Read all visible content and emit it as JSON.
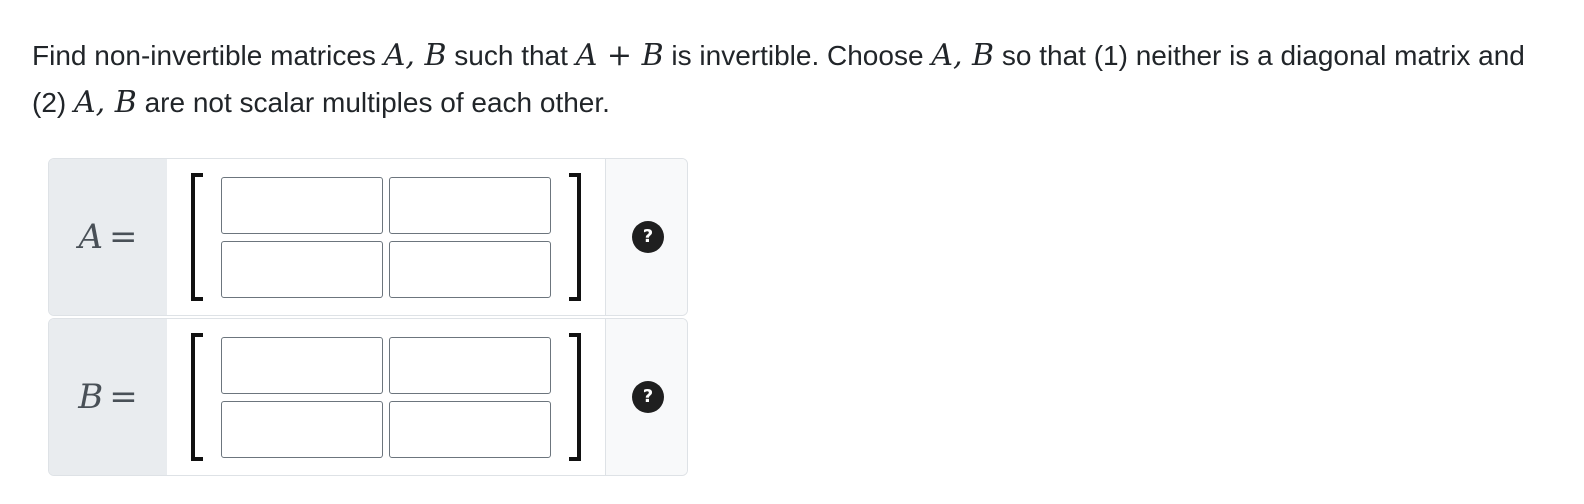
{
  "question": {
    "t1": "Find non-invertible matrices ",
    "m1": "A, B",
    "t2": " such that ",
    "m2a": "A",
    "m2op": " + ",
    "m2b": "B",
    "t3": " is invertible. Choose ",
    "m3": "A, B",
    "t4": " so that (1) neither is a diagonal matrix and (2) ",
    "m4": "A, B",
    "t5": " are not scalar multiples of each other."
  },
  "matrices": [
    {
      "var": "A",
      "eq": "=",
      "entries": [
        "",
        "",
        "",
        ""
      ],
      "help_icon": "?",
      "help_icon_name": "question-circle-icon"
    },
    {
      "var": "B",
      "eq": "=",
      "entries": [
        "",
        "",
        "",
        ""
      ],
      "help_icon": "?",
      "help_icon_name": "question-circle-icon"
    }
  ]
}
